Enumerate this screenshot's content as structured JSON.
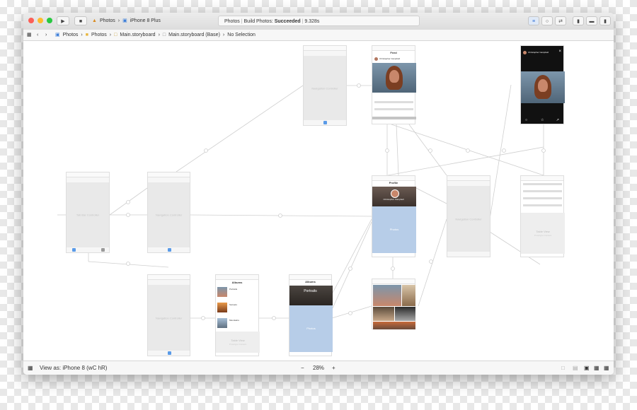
{
  "toolbar": {
    "run_icon": "play-icon",
    "stop_icon": "stop-icon",
    "scheme": {
      "app": "Photos",
      "device": "iPhone 8 Plus"
    },
    "status": {
      "app": "Photos",
      "task": "Build Photos:",
      "result": "Succeeded",
      "time": "9.328s"
    }
  },
  "jumpbar": {
    "crumbs": [
      "Photos",
      "Photos",
      "Main.storyboard",
      "Main.storyboard (Base)",
      "No Selection"
    ]
  },
  "scenes": {
    "tabbar": {
      "label": "Tab Bar Controller"
    },
    "nav1": {
      "label": "Navigation Controller"
    },
    "nav2": {
      "label": "Navigation Controller"
    },
    "nav3": {
      "label": "Navigation Controller"
    },
    "nav4": {
      "label": "Navigation Controller"
    },
    "feed": {
      "title": "Feed",
      "user": "Christopher Campbell"
    },
    "profile": {
      "title": "Profile",
      "name": "Christopher Campbell",
      "blue_label": "Photos"
    },
    "albums_list": {
      "title": "Albums",
      "rows": [
        "Portraits",
        "Sunsets",
        "Mountains"
      ],
      "table": "Table View",
      "table_sub": "Prototype Content"
    },
    "album_detail": {
      "title": "Albums",
      "header": "Portraits",
      "blue_label": "Photos"
    },
    "comments": {
      "table": "Table View",
      "table_sub": "Prototype Content"
    },
    "photo_detail": {
      "user": "Christopher Campbell"
    }
  },
  "bottombar": {
    "view_as": "View as: iPhone 8",
    "shortcut": "(wC hR)",
    "zoom": "28%",
    "minus": "−",
    "plus": "+"
  }
}
